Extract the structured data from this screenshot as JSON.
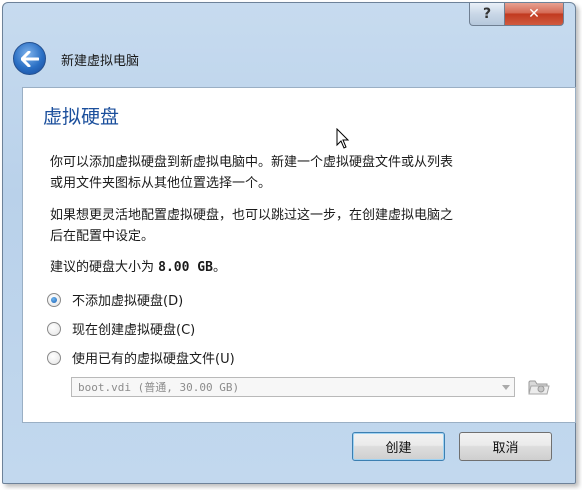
{
  "window": {
    "title": "新建虚拟电脑",
    "help_label": "?",
    "close_label": "✕"
  },
  "page": {
    "heading": "虚拟硬盘",
    "para1_line1": "你可以添加虚拟硬盘到新虚拟电脑中。新建一个虚拟硬盘文件或从列表",
    "para1_line2": "或用文件夹图标从其他位置选择一个。",
    "para2_line1": "如果想更灵活地配置虚拟硬盘，也可以跳过这一步，在创建虚拟电脑之",
    "para2_line2": "后在配置中设定。",
    "size_prefix": "建议的硬盘大小为",
    "size_value": "8.00 GB",
    "size_suffix": "。"
  },
  "options": [
    {
      "label": "不添加虚拟硬盘(D)",
      "checked": true
    },
    {
      "label": "现在创建虚拟硬盘(C)",
      "checked": false
    },
    {
      "label": "使用已有的虚拟硬盘文件(U)",
      "checked": false
    }
  ],
  "combo": {
    "value": "boot.vdi (普通, 30.00 GB)"
  },
  "buttons": {
    "create": "创建",
    "cancel": "取消"
  },
  "icons": {
    "back": "back-arrow-icon",
    "folder": "folder-icon"
  }
}
